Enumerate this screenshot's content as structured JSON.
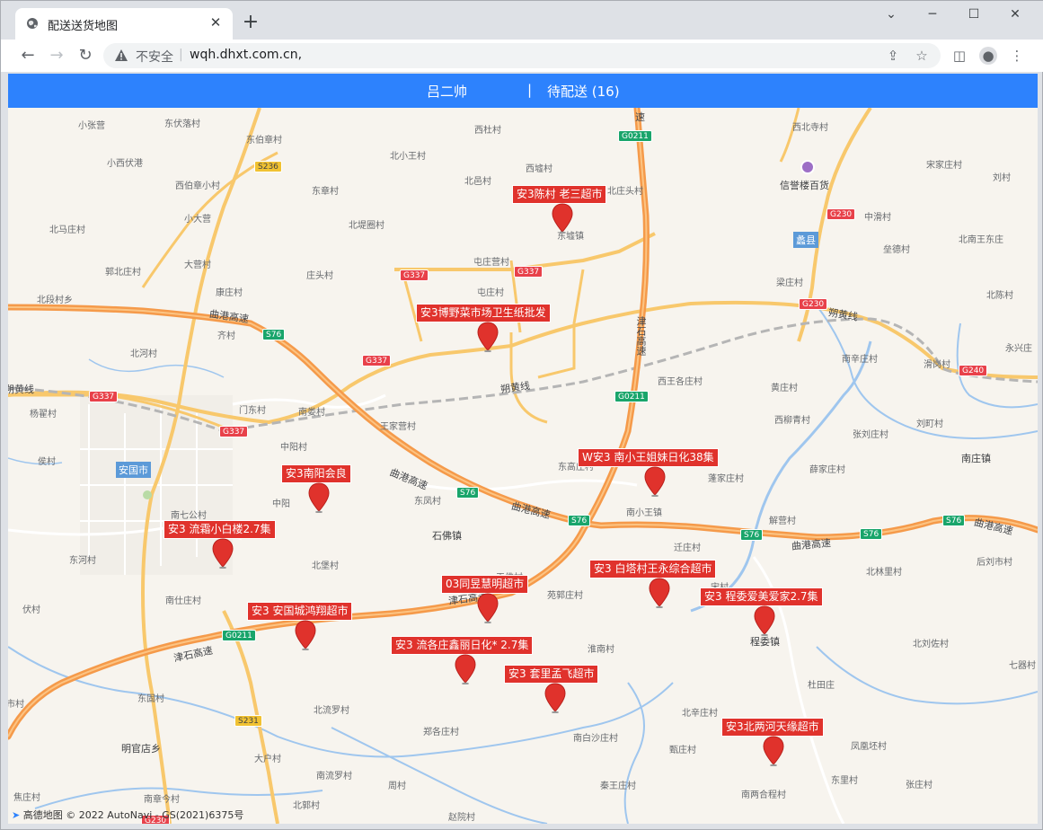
{
  "browser": {
    "tab_title": "配送送货地图",
    "new_tab_label": "+",
    "close_tab_label": "✕",
    "security_label": "不安全",
    "url": "wqh.dhxt.com.cn,",
    "window_controls": [
      "⌄",
      "─",
      "☐",
      "✕"
    ]
  },
  "header": {
    "user_name": "吕二帅",
    "separator": "|",
    "pending_label": "待配送 (16)"
  },
  "map": {
    "attribution": "高德地图 © 2022 AutoNavi - GS(2021)6375号",
    "route_shields": [
      {
        "id": "g0211-top",
        "text": "G0211",
        "color": "green"
      },
      {
        "id": "s236",
        "text": "S236",
        "color": "yellow"
      },
      {
        "id": "g230-a",
        "text": "G230",
        "color": "red"
      },
      {
        "id": "g337-a",
        "text": "G337",
        "color": "red"
      },
      {
        "id": "g337-b",
        "text": "G337",
        "color": "red"
      },
      {
        "id": "g230-b",
        "text": "G230",
        "color": "red"
      },
      {
        "id": "s76-a",
        "text": "S76",
        "color": "green"
      },
      {
        "id": "g337-c",
        "text": "G337",
        "color": "red"
      },
      {
        "id": "g240",
        "text": "G240",
        "color": "red"
      },
      {
        "id": "g337-d",
        "text": "G337",
        "color": "red"
      },
      {
        "id": "g0211-mid",
        "text": "G0211",
        "color": "green"
      },
      {
        "id": "g337-e",
        "text": "G337",
        "color": "red"
      },
      {
        "id": "s76-b",
        "text": "S76",
        "color": "green"
      },
      {
        "id": "s76-c",
        "text": "S76",
        "color": "green"
      },
      {
        "id": "s76-d",
        "text": "S76",
        "color": "green"
      },
      {
        "id": "s76-e",
        "text": "S76",
        "color": "green"
      },
      {
        "id": "s76-f",
        "text": "S76",
        "color": "green"
      },
      {
        "id": "g0211-low",
        "text": "G0211",
        "color": "green"
      },
      {
        "id": "s231",
        "text": "S231",
        "color": "yellow"
      },
      {
        "id": "g230-c",
        "text": "G230",
        "color": "red"
      }
    ],
    "highway_labels": [
      {
        "id": "quganggaosu-w",
        "text": "曲港高速"
      },
      {
        "id": "jinshigaosu-n",
        "text": "津石高速"
      },
      {
        "id": "shuohuangxian-e",
        "text": "朔黄线"
      },
      {
        "id": "shuohuangxian-c",
        "text": "朔黄线"
      },
      {
        "id": "shuohuangxian-w",
        "text": "朔黄线"
      },
      {
        "id": "quganggaosu-c1",
        "text": "曲港高速"
      },
      {
        "id": "quganggaosu-c2",
        "text": "曲港高速"
      },
      {
        "id": "quganggaosu-e1",
        "text": "曲港高速"
      },
      {
        "id": "quganggaosu-e2",
        "text": "曲港高速"
      },
      {
        "id": "jinshigaosu-s",
        "text": "津石高速"
      },
      {
        "id": "jinshigaosu-w",
        "text": "津石高速"
      },
      {
        "id": "su-top",
        "text": "速"
      }
    ],
    "towns": [
      {
        "id": "anguoshi",
        "text": "安国市"
      },
      {
        "id": "lixian",
        "text": "蠡县"
      }
    ],
    "poi": {
      "text": "信誉楼百货",
      "icon": "shopping-bag-icon"
    },
    "places": [
      {
        "text": "小张营"
      },
      {
        "text": "东伏落村"
      },
      {
        "text": "西杜村"
      },
      {
        "text": "西北寺村"
      },
      {
        "text": "东伯章村"
      },
      {
        "text": "北小王村"
      },
      {
        "text": "宋家庄村"
      },
      {
        "text": "刘村"
      },
      {
        "text": "小西伏港"
      },
      {
        "text": "西墟村"
      },
      {
        "text": "北邑村"
      },
      {
        "text": "北庄头村"
      },
      {
        "text": "西伯章小村"
      },
      {
        "text": "东章村"
      },
      {
        "text": "小大营"
      },
      {
        "text": "北堤圈村"
      },
      {
        "text": "东墟镇"
      },
      {
        "text": "中滑村"
      },
      {
        "text": "北马庄村"
      },
      {
        "text": "北南王东庄"
      },
      {
        "text": "垒德村"
      },
      {
        "text": "大营村"
      },
      {
        "text": "屯庄营村"
      },
      {
        "text": "郭北庄村"
      },
      {
        "text": "庄头村"
      },
      {
        "text": "梁庄村"
      },
      {
        "text": "康庄村"
      },
      {
        "text": "屯庄村"
      },
      {
        "text": "北段村乡"
      },
      {
        "text": "北陈村"
      },
      {
        "text": "齐村"
      },
      {
        "text": "北河村"
      },
      {
        "text": "南辛庄村"
      },
      {
        "text": "滑岗村"
      },
      {
        "text": "永兴庄"
      },
      {
        "text": "西王各庄村"
      },
      {
        "text": "黄庄村"
      },
      {
        "text": "杨翟村"
      },
      {
        "text": "门东村"
      },
      {
        "text": "南娄村"
      },
      {
        "text": "西柳青村"
      },
      {
        "text": "刘町村"
      },
      {
        "text": "王家营村"
      },
      {
        "text": "张刘庄村"
      },
      {
        "text": "中阳村"
      },
      {
        "text": "侯村"
      },
      {
        "text": "东高庄村"
      },
      {
        "text": "南庄镇"
      },
      {
        "text": "薛家庄村"
      },
      {
        "text": "蓬家庄村"
      },
      {
        "text": "中阳"
      },
      {
        "text": "东凤村"
      },
      {
        "text": "南七公村"
      },
      {
        "text": "南小王镇"
      },
      {
        "text": "解营村"
      },
      {
        "text": "石佛镇"
      },
      {
        "text": "后刘市村"
      },
      {
        "text": "东河村"
      },
      {
        "text": "迁庄村"
      },
      {
        "text": "北堡村"
      },
      {
        "text": "北林里村"
      },
      {
        "text": "王佛村"
      },
      {
        "text": "宋村"
      },
      {
        "text": "伏村"
      },
      {
        "text": "南仕庄村"
      },
      {
        "text": "苑郭庄村"
      },
      {
        "text": "程委镇"
      },
      {
        "text": "北刘佐村"
      },
      {
        "text": "淮南村"
      },
      {
        "text": "七器村"
      },
      {
        "text": "杜田庄"
      },
      {
        "text": "东固村"
      },
      {
        "text": "市村"
      },
      {
        "text": "北流罗村"
      },
      {
        "text": "郑各庄村"
      },
      {
        "text": "北辛庄村"
      },
      {
        "text": "明官店乡"
      },
      {
        "text": "大户村"
      },
      {
        "text": "南白沙庄村"
      },
      {
        "text": "甄庄村"
      },
      {
        "text": "凤凰坯村"
      },
      {
        "text": "南流罗村"
      },
      {
        "text": "东里村"
      },
      {
        "text": "张庄村"
      },
      {
        "text": "焦庄村"
      },
      {
        "text": "南章今村"
      },
      {
        "text": "周村"
      },
      {
        "text": "秦王庄村"
      },
      {
        "text": "南两合程村"
      },
      {
        "text": "北郭村"
      },
      {
        "text": "赵院村"
      }
    ],
    "markers": [
      {
        "id": "m1",
        "label": "安3陈村 老三超市"
      },
      {
        "id": "m2",
        "label": "安3博野菜市场卫生纸批发"
      },
      {
        "id": "m3",
        "label": "W安3  南小王姐妹日化38集"
      },
      {
        "id": "m4",
        "label": "安3南阳会良"
      },
      {
        "id": "m5",
        "label": "安3 流霜小白楼2.7集"
      },
      {
        "id": "m6",
        "label": "03同昱慧明超市"
      },
      {
        "id": "m7",
        "label": "安3 白塔村王永综合超市"
      },
      {
        "id": "m8",
        "label": "安3 程委爱美爱家2.7集"
      },
      {
        "id": "m9",
        "label": "安3  安国城鸿翔超市"
      },
      {
        "id": "m10",
        "label": "安3 流各庄鑫丽日化* 2.7集"
      },
      {
        "id": "m11",
        "label": "安3 套里孟飞超市"
      },
      {
        "id": "m12",
        "label": "安3北两河天缘超市"
      }
    ],
    "colors": {
      "header": "#2d82fd",
      "marker": "#e0322c",
      "highway": "#f59a4a",
      "national_road": "#f8c86c",
      "water": "#9fc6ee",
      "railway": "#b5b5b5"
    }
  }
}
